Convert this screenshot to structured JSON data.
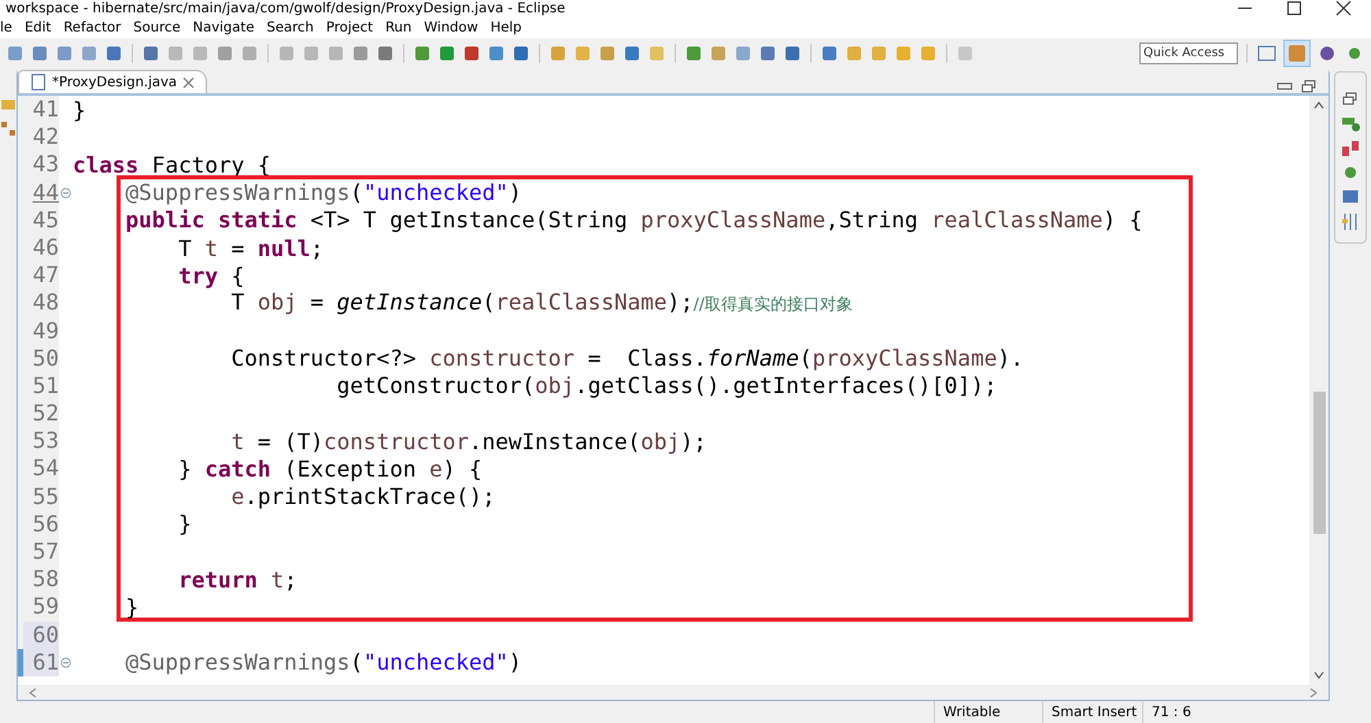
{
  "window": {
    "title": "workspace - hibernate/src/main/java/com/gwolf/design/ProxyDesign.java - Eclipse"
  },
  "menu": [
    "le",
    "Edit",
    "Refactor",
    "Source",
    "Navigate",
    "Search",
    "Project",
    "Run",
    "Window",
    "Help"
  ],
  "quick_access": {
    "placeholder": "Quick Access"
  },
  "tabs": [
    {
      "label": "*ProxyDesign.java",
      "selected": true
    }
  ],
  "editor": {
    "lines": [
      {
        "number": "41",
        "in_box": false,
        "selected": false,
        "marker": false,
        "fold": false,
        "tokens": [
          {
            "kind": "plain",
            "text": "}"
          }
        ]
      },
      {
        "number": "42",
        "in_box": false,
        "selected": false,
        "marker": false,
        "fold": false
      },
      {
        "number": "43",
        "in_box": false,
        "selected": false,
        "marker": false,
        "fold": false,
        "tokens": [
          {
            "kind": "kw",
            "text": "class"
          },
          {
            "kind": "plain",
            "text": " Factory {"
          }
        ]
      },
      {
        "number": "44",
        "in_box": true,
        "selected": false,
        "marker": false,
        "fold": true,
        "tokens": [
          {
            "kind": "ann",
            "text": "    @SuppressWarnings"
          },
          {
            "kind": "plain",
            "text": "("
          },
          {
            "kind": "str",
            "text": "\"unchecked\""
          },
          {
            "kind": "plain",
            "text": ")"
          }
        ]
      },
      {
        "number": "45",
        "in_box": true,
        "selected": false,
        "marker": false,
        "fold": false,
        "tokens": [
          {
            "kind": "kw",
            "text": "    public static"
          },
          {
            "kind": "plain",
            "text": " <T> T getInstance(String "
          },
          {
            "kind": "var",
            "text": "proxyClassName"
          },
          {
            "kind": "plain",
            "text": ",String "
          },
          {
            "kind": "var",
            "text": "realClassName"
          },
          {
            "kind": "plain",
            "text": ") {"
          }
        ]
      },
      {
        "number": "46",
        "in_box": true,
        "selected": false,
        "marker": false,
        "fold": false,
        "tokens": [
          {
            "kind": "plain",
            "text": "        T "
          },
          {
            "kind": "var",
            "text": "t"
          },
          {
            "kind": "plain",
            "text": " = "
          },
          {
            "kind": "kw",
            "text": "null"
          },
          {
            "kind": "plain",
            "text": ";"
          }
        ]
      },
      {
        "number": "47",
        "in_box": true,
        "selected": false,
        "marker": false,
        "fold": false,
        "tokens": [
          {
            "kind": "kw",
            "text": "        try"
          },
          {
            "kind": "plain",
            "text": " {"
          }
        ]
      },
      {
        "number": "48",
        "in_box": true,
        "selected": false,
        "marker": false,
        "fold": false,
        "tokens": [
          {
            "kind": "plain",
            "text": "            T "
          },
          {
            "kind": "var",
            "text": "obj"
          },
          {
            "kind": "plain",
            "text": " = "
          },
          {
            "kind": "italic",
            "text": "getInstance"
          },
          {
            "kind": "plain",
            "text": "("
          },
          {
            "kind": "var",
            "text": "realClassName"
          },
          {
            "kind": "plain",
            "text": ");"
          },
          {
            "kind": "comment",
            "text": "//取得真实的接口对象"
          }
        ]
      },
      {
        "number": "49",
        "in_box": true,
        "selected": false,
        "marker": false,
        "fold": false
      },
      {
        "number": "50",
        "in_box": true,
        "selected": false,
        "marker": false,
        "fold": false,
        "tokens": [
          {
            "kind": "plain",
            "text": "            Constructor<?> "
          },
          {
            "kind": "var",
            "text": "constructor"
          },
          {
            "kind": "plain",
            "text": " =  Class."
          },
          {
            "kind": "italic",
            "text": "forName"
          },
          {
            "kind": "plain",
            "text": "("
          },
          {
            "kind": "var",
            "text": "proxyClassName"
          },
          {
            "kind": "plain",
            "text": ")."
          }
        ]
      },
      {
        "number": "51",
        "in_box": true,
        "selected": false,
        "marker": false,
        "fold": false,
        "tokens": [
          {
            "kind": "plain",
            "text": "                    getConstructor("
          },
          {
            "kind": "var",
            "text": "obj"
          },
          {
            "kind": "plain",
            "text": ".getClass().getInterfaces()[0]);"
          }
        ]
      },
      {
        "number": "52",
        "in_box": true,
        "selected": false,
        "marker": false,
        "fold": false
      },
      {
        "number": "53",
        "in_box": true,
        "selected": false,
        "marker": false,
        "fold": false,
        "tokens": [
          {
            "kind": "var",
            "text": "            t"
          },
          {
            "kind": "plain",
            "text": " = (T)"
          },
          {
            "kind": "var",
            "text": "constructor"
          },
          {
            "kind": "plain",
            "text": ".newInstance("
          },
          {
            "kind": "var",
            "text": "obj"
          },
          {
            "kind": "plain",
            "text": ");"
          }
        ]
      },
      {
        "number": "54",
        "in_box": true,
        "selected": false,
        "marker": false,
        "fold": false,
        "tokens": [
          {
            "kind": "plain",
            "text": "        } "
          },
          {
            "kind": "kw",
            "text": "catch"
          },
          {
            "kind": "plain",
            "text": " (Exception "
          },
          {
            "kind": "var",
            "text": "e"
          },
          {
            "kind": "plain",
            "text": ") {"
          }
        ]
      },
      {
        "number": "55",
        "in_box": true,
        "selected": false,
        "marker": false,
        "fold": false,
        "tokens": [
          {
            "kind": "var",
            "text": "            e"
          },
          {
            "kind": "plain",
            "text": ".printStackTrace();"
          }
        ]
      },
      {
        "number": "56",
        "in_box": true,
        "selected": false,
        "marker": false,
        "fold": false,
        "tokens": [
          {
            "kind": "plain",
            "text": "        }"
          }
        ]
      },
      {
        "number": "57",
        "in_box": true,
        "selected": false,
        "marker": false,
        "fold": false
      },
      {
        "number": "58",
        "in_box": true,
        "selected": false,
        "marker": false,
        "fold": false,
        "tokens": [
          {
            "kind": "kw",
            "text": "        return"
          },
          {
            "kind": "var",
            "text": " t"
          },
          {
            "kind": "plain",
            "text": ";"
          }
        ]
      },
      {
        "number": "59",
        "in_box": true,
        "selected": false,
        "marker": false,
        "fold": false,
        "tokens": [
          {
            "kind": "plain",
            "text": "    }"
          }
        ]
      },
      {
        "number": "60",
        "in_box": false,
        "selected": true,
        "marker": false,
        "fold": false
      },
      {
        "number": "61",
        "in_box": false,
        "selected": true,
        "marker": true,
        "fold": true,
        "tokens": [
          {
            "kind": "ann",
            "text": "    @SuppressWarnings"
          },
          {
            "kind": "plain",
            "text": "("
          },
          {
            "kind": "str",
            "text": "\"unchecked\""
          },
          {
            "kind": "plain",
            "text": ")"
          }
        ]
      }
    ]
  },
  "status_bar": [
    "Writable",
    "Smart Insert",
    "71 : 6"
  ]
}
